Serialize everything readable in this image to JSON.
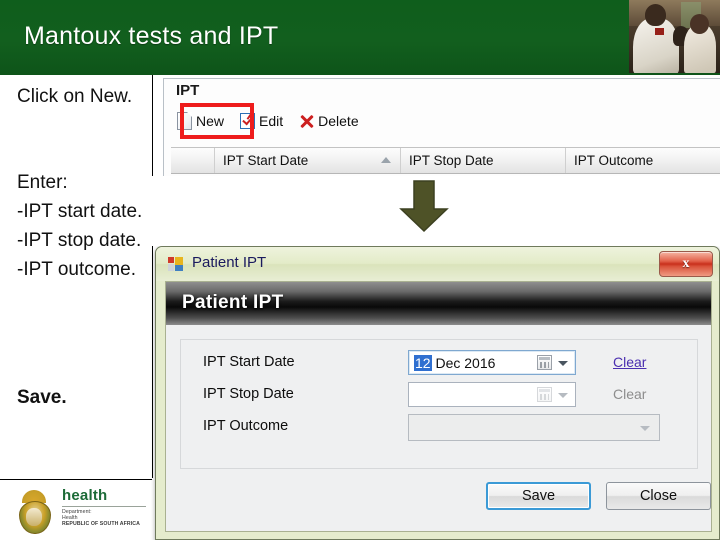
{
  "header": {
    "title": "Mantoux tests and IPT",
    "photo_alt": "health-worker-vaccinating-child-photo",
    "bg_color": "#13631f"
  },
  "sidebar": {
    "instructions": {
      "click_new": "Click on New.",
      "enter_block": "Enter: -IPT start date. -IPT stop date. -IPT outcome.",
      "save": "Save."
    },
    "logo": {
      "wordmark": "health",
      "line1": "Department:",
      "line2": "Health",
      "line3": "REPUBLIC OF SOUTH AFRICA"
    }
  },
  "ipt_panel": {
    "group_label": "IPT",
    "toolbar": [
      {
        "label": "New",
        "icon": "new-page-icon",
        "highlighted": true
      },
      {
        "label": "Edit",
        "icon": "edit-checkbox-icon",
        "highlighted": false
      },
      {
        "label": "Delete",
        "icon": "delete-red-x-icon",
        "highlighted": false
      }
    ],
    "grid_columns": [
      "",
      "IPT Start Date",
      "IPT Stop Date",
      "IPT Outcome"
    ],
    "sort_column": "IPT Start Date",
    "sort_direction": "ascending",
    "highlight_color": "#ee1c1c"
  },
  "arrow": {
    "name": "down-arrow",
    "color": "#4e5227"
  },
  "dialog": {
    "title": "Patient IPT",
    "title_icon": "form-window-icon",
    "close_label": "x",
    "banner_text": "Patient IPT",
    "fields": [
      {
        "label": "IPT Start Date",
        "value_selected": "12",
        "value_rest": " Dec 2016",
        "clear_label": "Clear",
        "clear_enabled": true,
        "type": "date-picker"
      },
      {
        "label": "IPT Stop Date",
        "value_selected": "",
        "value_rest": "",
        "clear_label": "Clear",
        "clear_enabled": false,
        "type": "date-picker"
      },
      {
        "label": "IPT Outcome",
        "value_selected": "",
        "value_rest": "",
        "clear_label": "",
        "clear_enabled": false,
        "type": "combo-box"
      }
    ],
    "buttons": {
      "save": "Save",
      "close": "Close"
    }
  }
}
